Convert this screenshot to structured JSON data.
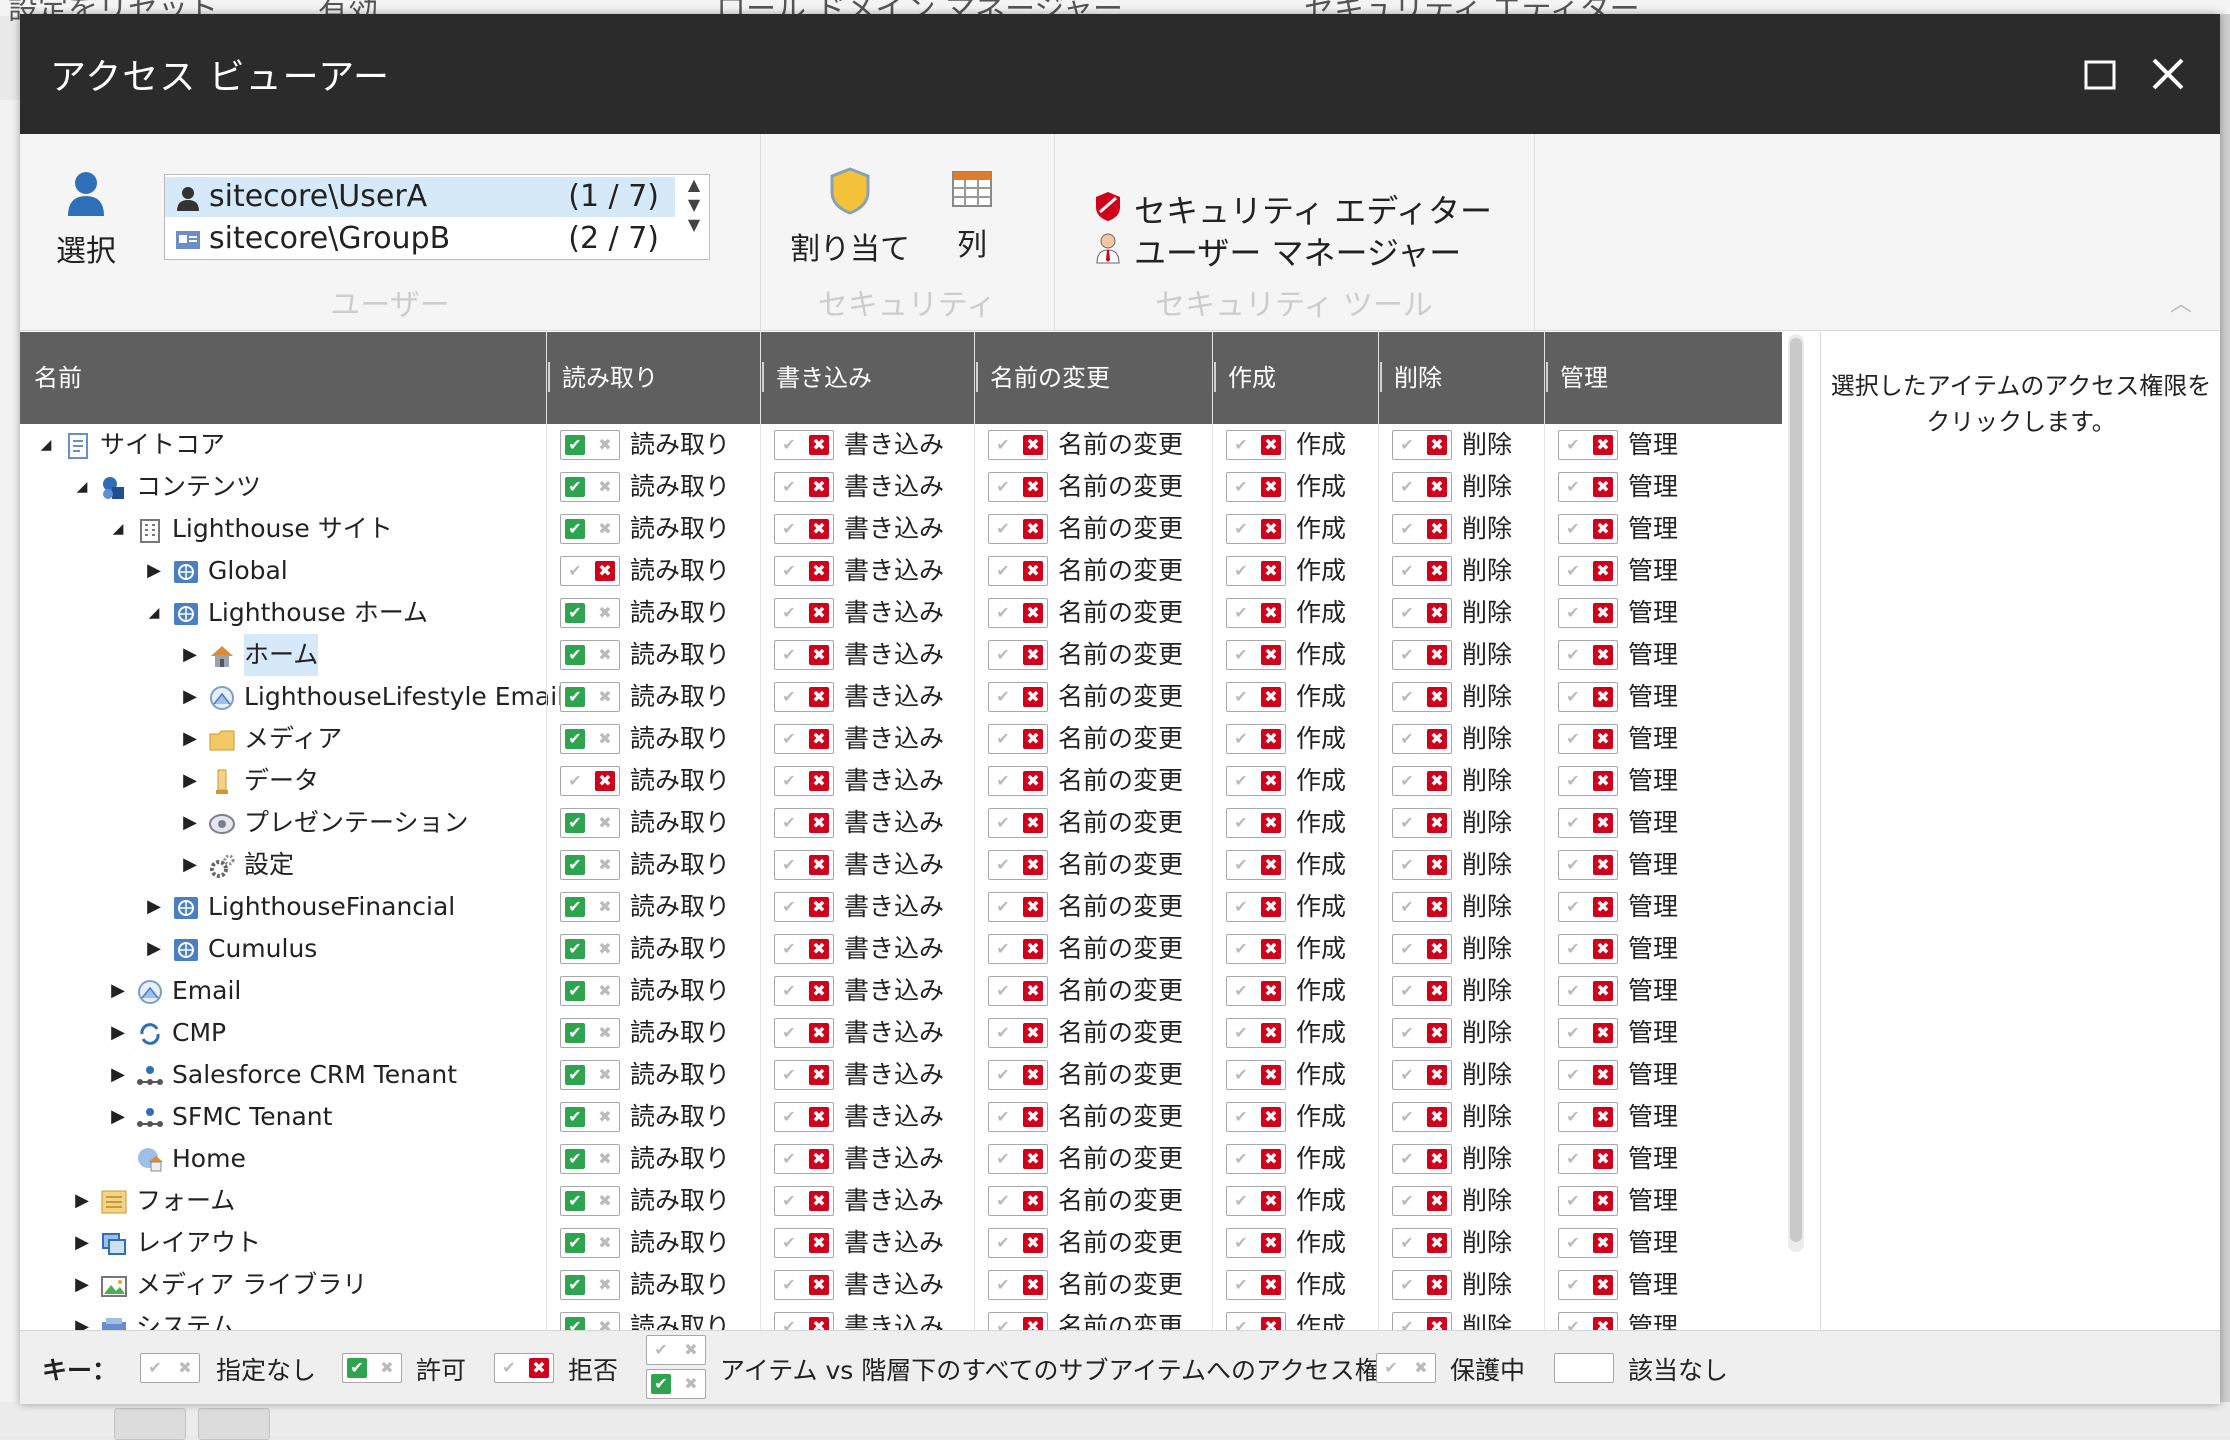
{
  "background": {
    "top_texts": [
      "設定をリセット",
      "有効",
      "ロール ドメイン マネージャー",
      "セキュリティ エディター"
    ]
  },
  "dialog": {
    "title": "アクセス ビューアー",
    "maximize_icon": "maximize-icon",
    "close_icon": "close-icon"
  },
  "ribbon": {
    "users_group": {
      "label": "ユーザー",
      "select_button": "選択",
      "users": [
        {
          "name": "sitecore\\UserA",
          "count": "(1 / 7)",
          "selected": true
        },
        {
          "name": "sitecore\\GroupB",
          "count": "(2 / 7)",
          "selected": false
        }
      ]
    },
    "security_group": {
      "label": "セキュリティ",
      "assign_button": "割り当て",
      "columns_button": "列"
    },
    "tools_group": {
      "label": "セキュリティ ツール",
      "security_editor": "セキュリティ エディター",
      "user_manager": "ユーザー マネージャー"
    }
  },
  "grid": {
    "headers": {
      "name": "名前",
      "read": "読み取り",
      "write": "書き込み",
      "rename": "名前の変更",
      "create": "作成",
      "delete": "削除",
      "admin": "管理"
    },
    "rows": [
      {
        "name": "サイトコア",
        "level": 0,
        "arrow": "expanded",
        "icon": "document-icon",
        "read_allowed": true
      },
      {
        "name": "コンテンツ",
        "level": 1,
        "arrow": "expanded",
        "icon": "content-icon",
        "read_allowed": true
      },
      {
        "name": "Lighthouse サイト",
        "level": 2,
        "arrow": "expanded",
        "icon": "building-icon",
        "read_allowed": true
      },
      {
        "name": "Global",
        "level": 3,
        "arrow": "collapsed",
        "icon": "globe-icon",
        "read_allowed": false
      },
      {
        "name": "Lighthouse ホーム",
        "level": 3,
        "arrow": "expanded",
        "icon": "globe-icon",
        "read_allowed": true
      },
      {
        "name": "ホーム",
        "level": 4,
        "arrow": "collapsed",
        "icon": "home-icon",
        "read_allowed": true,
        "selected": true
      },
      {
        "name": "LighthouseLifestyle Emails",
        "level": 4,
        "arrow": "collapsed",
        "icon": "email-icon",
        "read_allowed": true
      },
      {
        "name": "メディア",
        "level": 4,
        "arrow": "collapsed",
        "icon": "folder-icon",
        "read_allowed": true
      },
      {
        "name": "データ",
        "level": 4,
        "arrow": "collapsed",
        "icon": "data-icon",
        "read_allowed": false
      },
      {
        "name": "プレゼンテーション",
        "level": 4,
        "arrow": "collapsed",
        "icon": "presentation-icon",
        "read_allowed": true
      },
      {
        "name": "設定",
        "level": 4,
        "arrow": "collapsed",
        "icon": "gear-icon",
        "read_allowed": true
      },
      {
        "name": "LighthouseFinancial",
        "level": 3,
        "arrow": "collapsed",
        "icon": "globe-icon",
        "read_allowed": true
      },
      {
        "name": "Cumulus",
        "level": 3,
        "arrow": "collapsed",
        "icon": "globe-icon",
        "read_allowed": true
      },
      {
        "name": "Email",
        "level": 2,
        "arrow": "collapsed",
        "icon": "email-icon",
        "read_allowed": true
      },
      {
        "name": "CMP",
        "level": 2,
        "arrow": "collapsed",
        "icon": "sync-icon",
        "read_allowed": true
      },
      {
        "name": "Salesforce CRM Tenant",
        "level": 2,
        "arrow": "collapsed",
        "icon": "network-icon",
        "read_allowed": true
      },
      {
        "name": "SFMC Tenant",
        "level": 2,
        "arrow": "collapsed",
        "icon": "network-icon",
        "read_allowed": true
      },
      {
        "name": "Home",
        "level": 2,
        "arrow": "none",
        "icon": "globe-home-icon",
        "read_allowed": true
      },
      {
        "name": "フォーム",
        "level": 1,
        "arrow": "collapsed",
        "icon": "form-icon",
        "read_allowed": true
      },
      {
        "name": "レイアウト",
        "level": 1,
        "arrow": "collapsed",
        "icon": "layout-icon",
        "read_allowed": true
      },
      {
        "name": "メディア ライブラリ",
        "level": 1,
        "arrow": "collapsed",
        "icon": "media-library-icon",
        "read_allowed": true
      },
      {
        "name": "システム",
        "level": 1,
        "arrow": "collapsed",
        "icon": "system-icon",
        "read_allowed": true
      }
    ]
  },
  "right_panel": {
    "hint": "選択したアイテムのアクセス権限をクリックします。"
  },
  "legend": {
    "key_label": "キー：",
    "items": [
      {
        "label": "指定なし"
      },
      {
        "label": "許可"
      },
      {
        "label": "拒否"
      },
      {
        "label": "アイテム vs 階層下のすべてのサブアイテムへのアクセス権"
      },
      {
        "label": "保護中"
      },
      {
        "label": "該当なし"
      }
    ]
  },
  "colors": {
    "titlebar": "#2b2b2b",
    "header": "#5f5f5f",
    "allow_green": "#2ea44f",
    "deny_red": "#d0021b",
    "selection_blue": "#d6e9f8"
  }
}
